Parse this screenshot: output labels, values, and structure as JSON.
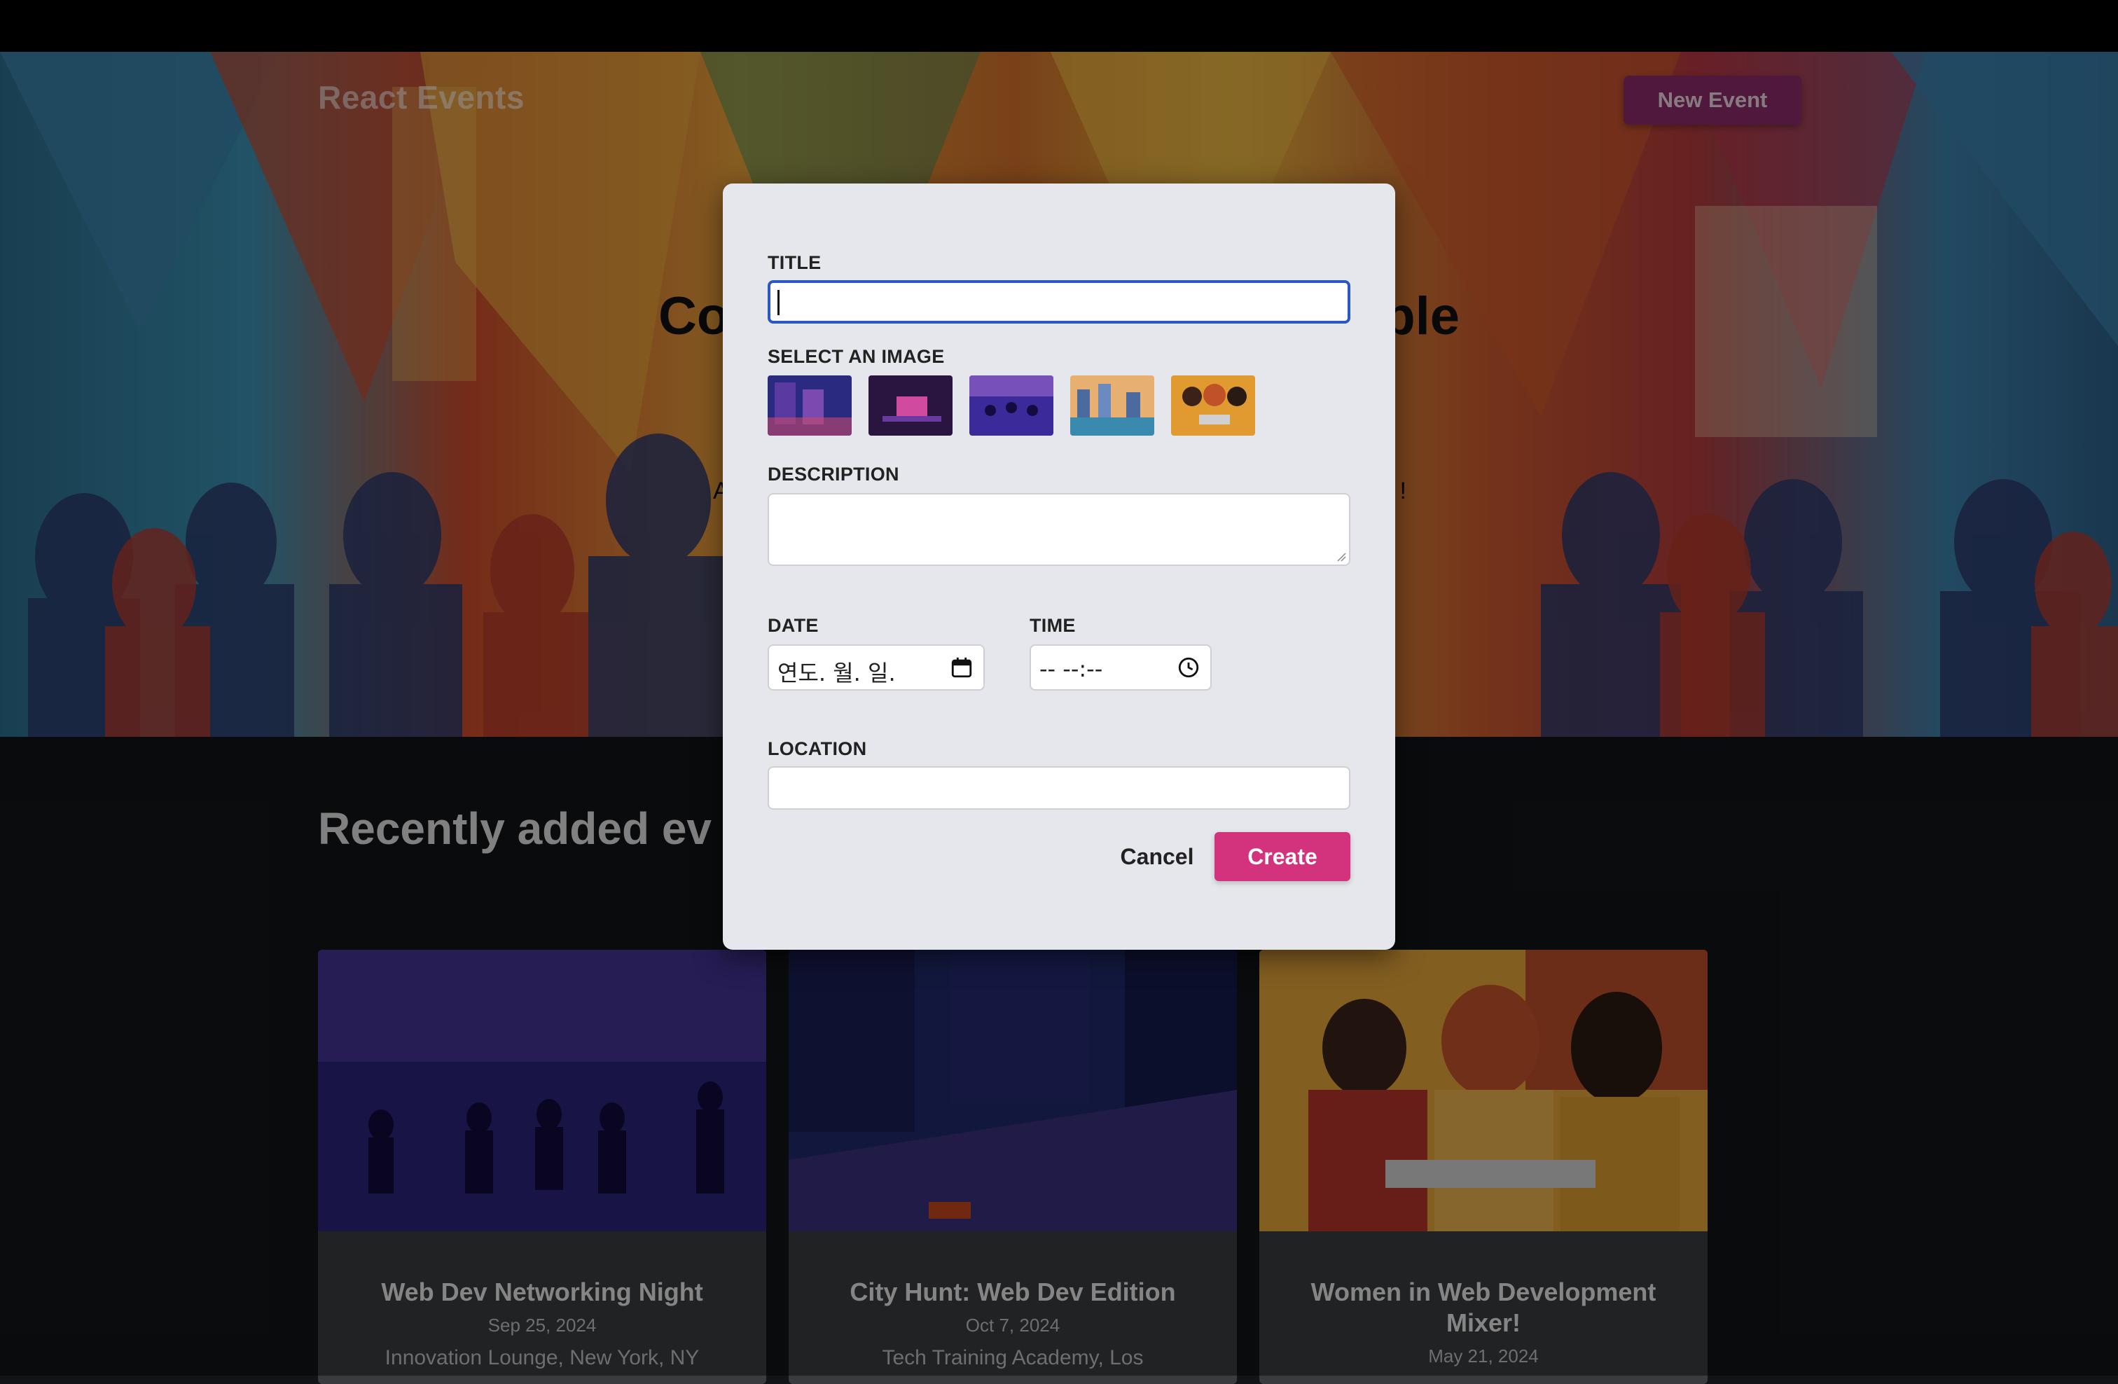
{
  "header": {
    "brand": "React Events",
    "new_event_label": "New Event"
  },
  "hero": {
    "title_left": "Co",
    "title_right": "ple",
    "subtitle_left": "A",
    "subtitle_right": "!"
  },
  "section": {
    "title": "Recently added ev"
  },
  "modal": {
    "title_label": "TITLE",
    "title_value": "",
    "image_label": "SELECT AN IMAGE",
    "images": [
      "city-night-image",
      "desk-setup-image",
      "party-crowd-image",
      "city-river-image",
      "women-laptop-image"
    ],
    "description_label": "DESCRIPTION",
    "description_value": "",
    "date_label": "DATE",
    "date_placeholder": "연도. 월. 일.",
    "time_label": "TIME",
    "time_placeholder": "-- --:--",
    "location_label": "LOCATION",
    "location_value": "",
    "cancel_label": "Cancel",
    "create_label": "Create"
  },
  "events": [
    {
      "title": "Web Dev Networking Night",
      "date": "Sep 25, 2024",
      "location": "Innovation Lounge, New York, NY"
    },
    {
      "title": "City Hunt: Web Dev Edition",
      "date": "Oct 7, 2024",
      "location": "Tech Training Academy, Los"
    },
    {
      "title": "Women in Web Development Mixer!",
      "date": "May 21, 2024",
      "location": ""
    }
  ],
  "colors": {
    "accent": "#d3337c",
    "focus": "#2a56c6",
    "modal_bg": "#e6e7ec"
  }
}
